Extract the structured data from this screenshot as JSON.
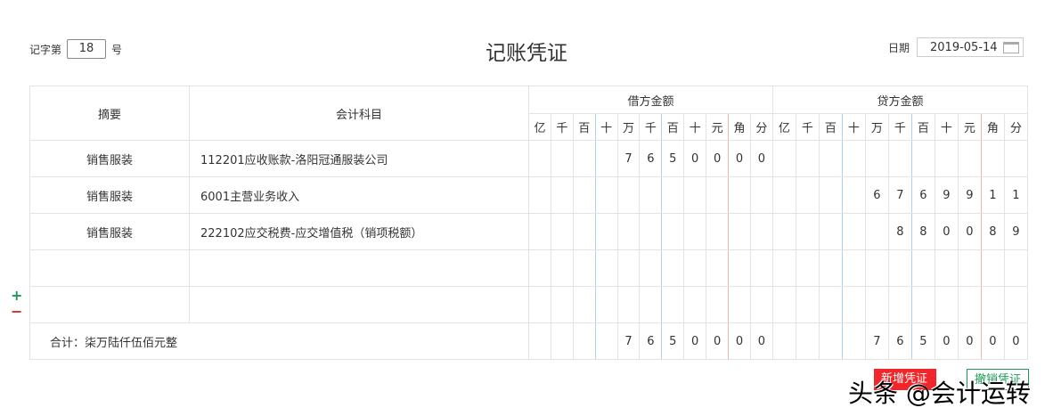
{
  "header": {
    "prefix": "记字第",
    "number": "18",
    "suffix": "号",
    "title": "记账凭证",
    "date_label": "日期",
    "date": "2019-05-14"
  },
  "columns": {
    "summary": "摘要",
    "account": "会计科目",
    "debit": "借方金额",
    "credit": "贷方金额",
    "units": [
      "亿",
      "千",
      "百",
      "十",
      "万",
      "千",
      "百",
      "十",
      "元",
      "角",
      "分"
    ]
  },
  "rows": [
    {
      "summary": "销售服装",
      "account": "112201应收账款-洛阳冠通服装公司",
      "debit": "    7650000",
      "credit": "           "
    },
    {
      "summary": "销售服装",
      "account": "6001主营业务收入",
      "debit": "           ",
      "credit": "    6769911"
    },
    {
      "summary": "销售服装",
      "account": "222102应交税费-应交增值税（销项税额）",
      "debit": "           ",
      "credit": "     880089"
    },
    {
      "summary": "",
      "account": "",
      "debit": "           ",
      "credit": "           "
    },
    {
      "summary": "",
      "account": "",
      "debit": "           ",
      "credit": "           "
    }
  ],
  "total": {
    "label": "合计：柒万陆仟伍佰元整",
    "debit": "    7650000",
    "credit": "    7650000"
  },
  "controls": {
    "add": "+",
    "remove": "−"
  },
  "buttons": {
    "new": "新增凭证",
    "undo": "撤销凭证"
  },
  "watermark": "头条 @会计运转"
}
